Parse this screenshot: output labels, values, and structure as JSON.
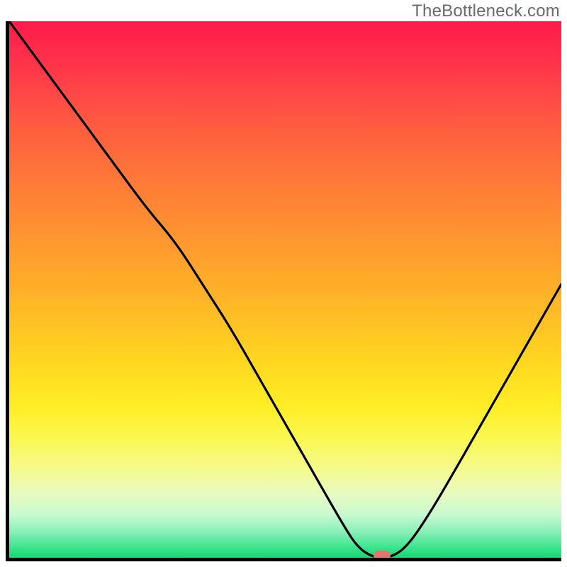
{
  "watermark": {
    "text": "TheBottleneck.com"
  },
  "chart_data": {
    "type": "line",
    "title": "",
    "xlabel": "",
    "ylabel": "",
    "xlim": [
      0,
      1
    ],
    "ylim": [
      0,
      1
    ],
    "x": [
      0.0,
      0.05,
      0.1,
      0.15,
      0.2,
      0.25,
      0.3,
      0.35,
      0.4,
      0.45,
      0.5,
      0.55,
      0.6,
      0.63,
      0.66,
      0.69,
      0.72,
      0.76,
      0.8,
      0.85,
      0.9,
      0.95,
      1.0
    ],
    "values": [
      1.0,
      0.93,
      0.86,
      0.79,
      0.72,
      0.65,
      0.59,
      0.51,
      0.43,
      0.34,
      0.25,
      0.16,
      0.07,
      0.02,
      0.0,
      0.0,
      0.02,
      0.08,
      0.15,
      0.24,
      0.33,
      0.42,
      0.51
    ],
    "marker": {
      "x": 0.675,
      "y": 0.0
    },
    "gradient": {
      "top_color": "#ff1a4b",
      "mid_color": "#ffd820",
      "bottom_color": "#13d873"
    }
  }
}
